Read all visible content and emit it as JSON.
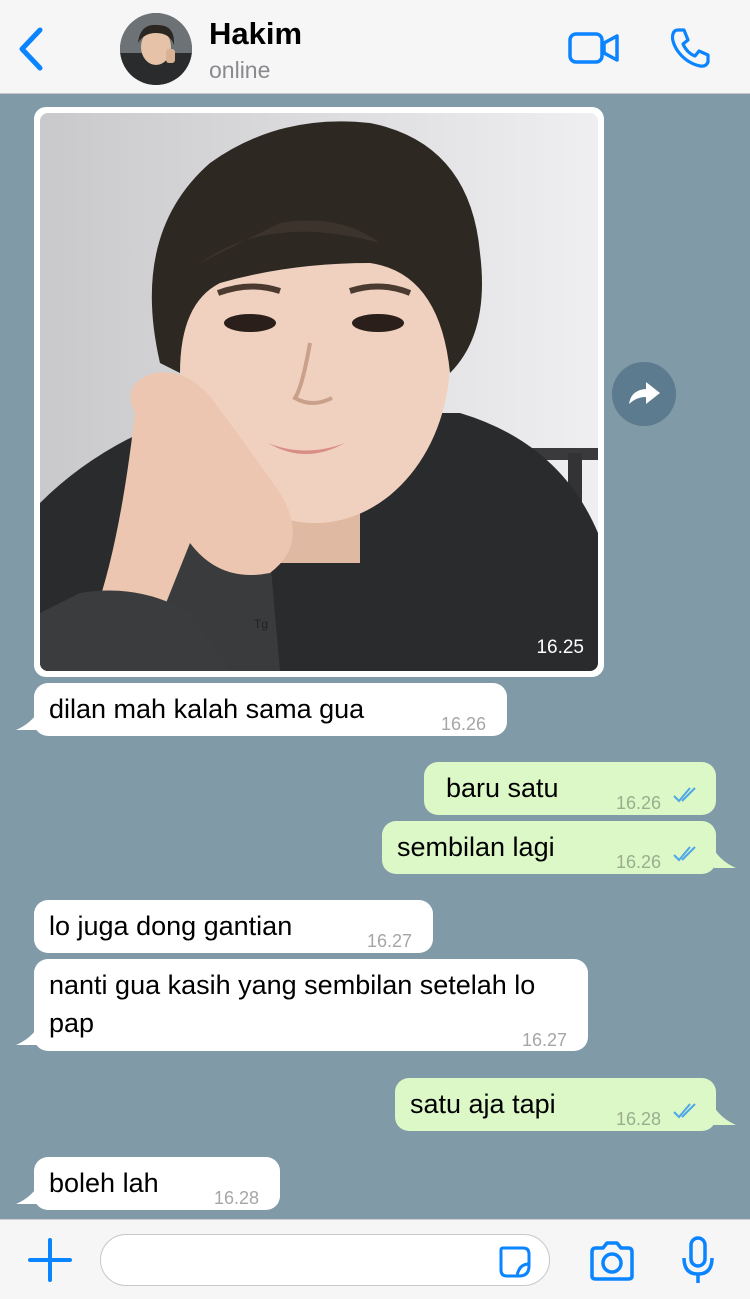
{
  "header": {
    "contact_name": "Hakim",
    "status": "online",
    "accent_color": "#0a84ff"
  },
  "image_message": {
    "time": "16.25",
    "watermark": "Tg"
  },
  "messages": [
    {
      "direction": "in",
      "text": "dilan mah kalah sama gua",
      "time": "16.26"
    },
    {
      "direction": "out",
      "text": "baru satu",
      "time": "16.26",
      "ticks": "read"
    },
    {
      "direction": "out",
      "text": "sembilan lagi",
      "time": "16.26",
      "ticks": "read"
    },
    {
      "direction": "in",
      "text": "lo juga dong gantian",
      "time": "16.27"
    },
    {
      "direction": "in",
      "text": "nanti gua kasih yang sembilan setelah lo pap",
      "time": "16.27"
    },
    {
      "direction": "out",
      "text": "satu aja tapi",
      "time": "16.28",
      "ticks": "read"
    },
    {
      "direction": "in",
      "text": "boleh lah",
      "time": "16.28"
    }
  ],
  "composer": {
    "placeholder": ""
  },
  "colors": {
    "chat_background": "#819aa8",
    "incoming_bubble": "#ffffff",
    "outgoing_bubble": "#dcf8c6",
    "read_tick": "#4fa6e8"
  }
}
